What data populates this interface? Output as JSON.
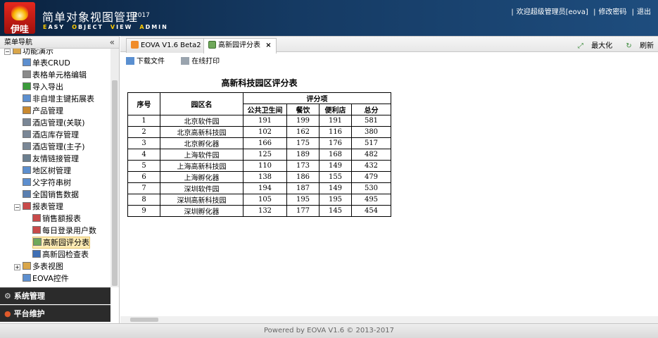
{
  "header": {
    "logo_text": "伊哇",
    "title": "简单对象视图管理",
    "year": "2017",
    "subtitle_letters": [
      {
        "h": "E",
        "r": "ASY"
      },
      {
        "h": "O",
        "r": "BJECT"
      },
      {
        "h": "V",
        "r": "IEW"
      },
      {
        "h": "A",
        "r": "DMIN"
      }
    ],
    "welcome": "欢迎超级管理员[eova]",
    "change_password": "修改密码",
    "logout": "退出"
  },
  "sidebar": {
    "title": "菜单导航",
    "collapse_glyph": "«",
    "items": [
      {
        "label": "功能演示",
        "indent": 1,
        "exp": "−",
        "icon": "folder-icon"
      },
      {
        "label": "单表CRUD",
        "indent": 2,
        "icon": "table-icon"
      },
      {
        "label": "表格单元格编辑",
        "indent": 2,
        "icon": "gear-icon"
      },
      {
        "label": "导入导出",
        "indent": 2,
        "icon": "import-export-icon"
      },
      {
        "label": "非自增主键拓展表",
        "indent": 2,
        "icon": "table-icon"
      },
      {
        "label": "产品管理",
        "indent": 2,
        "icon": "box-icon"
      },
      {
        "label": "酒店管理(关联)",
        "indent": 2,
        "icon": "building-icon"
      },
      {
        "label": "酒店库存管理",
        "indent": 2,
        "icon": "building-icon"
      },
      {
        "label": "酒店管理(主子)",
        "indent": 2,
        "icon": "building-icon"
      },
      {
        "label": "友情链接管理",
        "indent": 2,
        "icon": "link-icon"
      },
      {
        "label": "地区树管理",
        "indent": 2,
        "icon": "tree-icon"
      },
      {
        "label": "父字符串树",
        "indent": 2,
        "icon": "tree-icon"
      },
      {
        "label": "全国销售数据",
        "indent": 2,
        "icon": "calculator-icon"
      },
      {
        "label": "报表管理",
        "indent": 2,
        "exp": "−",
        "icon": "chart-icon"
      },
      {
        "label": "销售额报表",
        "indent": 3,
        "icon": "chart-icon"
      },
      {
        "label": "每日登录用户数",
        "indent": 3,
        "icon": "chart-icon"
      },
      {
        "label": "高新园评分表",
        "indent": 3,
        "icon": "report-icon",
        "selected": true
      },
      {
        "label": "高新园检查表",
        "indent": 3,
        "icon": "check-icon"
      },
      {
        "label": "多表视图",
        "indent": 2,
        "exp": "+",
        "icon": "folder-icon"
      },
      {
        "label": "EOVA控件",
        "indent": 2,
        "icon": "table-icon"
      }
    ],
    "accordions": [
      {
        "label": "系统管理",
        "icon": "gear-icon"
      },
      {
        "label": "平台维护",
        "icon": "palette-icon"
      }
    ]
  },
  "tabs": [
    {
      "label": "EOVA V1.6 Beta2",
      "icon": "rss-icon",
      "active": false
    },
    {
      "label": "高新园评分表",
      "icon": "report-icon",
      "active": true,
      "close": "×"
    }
  ],
  "tab_actions": {
    "maximize": "最大化",
    "refresh": "刷新"
  },
  "toolbar": {
    "download": "下载文件",
    "print": "在线打印"
  },
  "report": {
    "title": "高新科技园区评分表",
    "headers": {
      "no": "序号",
      "park": "园区名",
      "group": "评分项",
      "cols": [
        "公共卫生间",
        "餐饮",
        "便利店",
        "总分"
      ]
    },
    "rows": [
      [
        "1",
        "北京软件园",
        "191",
        "199",
        "191",
        "581"
      ],
      [
        "2",
        "北京高新科技园",
        "102",
        "162",
        "116",
        "380"
      ],
      [
        "3",
        "北京孵化器",
        "166",
        "175",
        "176",
        "517"
      ],
      [
        "4",
        "上海软件园",
        "125",
        "189",
        "168",
        "482"
      ],
      [
        "5",
        "上海高新科技园",
        "110",
        "173",
        "149",
        "432"
      ],
      [
        "6",
        "上海孵化器",
        "138",
        "186",
        "155",
        "479"
      ],
      [
        "7",
        "深圳软件园",
        "194",
        "187",
        "149",
        "530"
      ],
      [
        "8",
        "深圳高新科技园",
        "105",
        "195",
        "195",
        "495"
      ],
      [
        "9",
        "深圳孵化器",
        "132",
        "177",
        "145",
        "454"
      ]
    ]
  },
  "footer": "Powered by EOVA V1.6 © 2013-2017"
}
